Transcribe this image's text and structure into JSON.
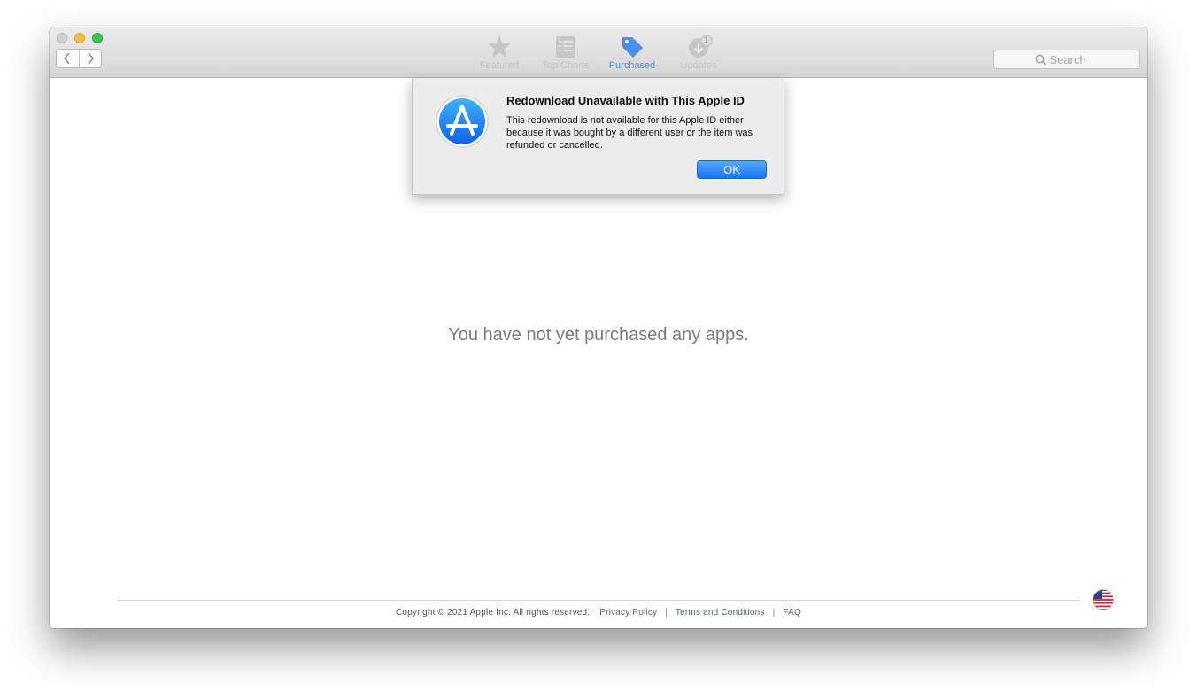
{
  "toolbar": {
    "tabs": [
      {
        "label": "Featured",
        "icon": "star-icon"
      },
      {
        "label": "Top Charts",
        "icon": "list-icon"
      },
      {
        "label": "Purchased",
        "icon": "tag-icon",
        "active": true
      },
      {
        "label": "Updates",
        "icon": "updates-icon",
        "badge": "1"
      }
    ],
    "search_placeholder": "Search"
  },
  "main": {
    "empty_message": "You have not yet purchased any apps."
  },
  "footer": {
    "copyright": "Copyright © 2021 Apple Inc. All rights reserved.",
    "privacy": "Privacy Policy",
    "separator": "|",
    "terms": "Terms and Conditions",
    "faq": "FAQ",
    "flag_icon": "us-flag-icon"
  },
  "alert": {
    "title": "Redownload Unavailable with This Apple ID",
    "body": "This redownload is not available for this Apple ID either because it was bought by a different user or the item was refunded or cancelled.",
    "ok_label": "OK",
    "icon": "app-store-icon"
  },
  "colors": {
    "accent": "#4a8ef0",
    "ok_button": "#1a73f5",
    "inactive_tab": "#c4c4c4"
  }
}
